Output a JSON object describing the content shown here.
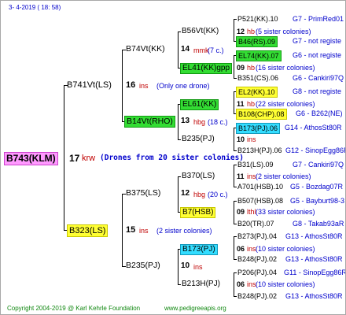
{
  "header": {
    "date_line": "3-   4-2019  ( 18:  58)"
  },
  "footer": {
    "copyright": "Copyright 2004-2019 @ Karl Kehrle Foundation",
    "website": "www.pedigreeapis.org"
  },
  "colors": {
    "pink": "#ff99ff",
    "green": "#33dd33",
    "yellow": "#ffff33",
    "cyan": "#33ddff",
    "blue_text": "#0000cc",
    "red_text": "#c00000"
  },
  "root": {
    "name": "B743(KLM)",
    "score": "17",
    "marker": "krw",
    "colony_note": "(Drones from 20 sister colonies)"
  },
  "gen1": {
    "upper": {
      "name": "B741Vt(LS)",
      "score": "16",
      "marker": "ins",
      "note": "(Only one drone)"
    },
    "lower": {
      "name": "B323(LS)",
      "score": "15",
      "marker": "ins",
      "note": "(2 sister colonies)"
    }
  },
  "gen2": {
    "b74vt": {
      "name": "B74Vt(KK)",
      "score": "14",
      "marker": "mmk",
      "note": "(7 c.)"
    },
    "b14vt": {
      "name": "B14Vt(RHO)",
      "score": "13",
      "marker": "hbg",
      "note": "(18 c.)"
    },
    "b375": {
      "name": "B375(LS)",
      "score": "12",
      "marker": "hbg",
      "note": "(20 c.)"
    },
    "b235": {
      "name": "B235(PJ)",
      "score": "10",
      "marker": "ins",
      "note": ""
    }
  },
  "gen3": [
    {
      "name": "B56Vt(KK)",
      "score": "12",
      "marker": "hb",
      "note": "(5 sister colonies)"
    },
    {
      "name": "EL41(KK)gpp",
      "score": "09",
      "marker": "hb",
      "note": "(16 sister colonies)"
    },
    {
      "name": "EL61(KK)",
      "score": "11",
      "marker": "hb",
      "note": "(22 sister colonies)"
    },
    {
      "name": "B235(PJ)",
      "score": "10",
      "marker": "ins",
      "note": ""
    },
    {
      "name": "B370(LS)",
      "score": "11",
      "marker": "ins",
      "note": "(2 sister colonies)"
    },
    {
      "name": "B7(HSB)",
      "score": "09",
      "marker": "lthl",
      "note": "(33 sister colonies)"
    },
    {
      "name": "B173(PJ)",
      "score": "06",
      "marker": "ins",
      "note": "(10 sister colonies)"
    },
    {
      "name": "B213H(PJ)",
      "score": "06",
      "marker": "ins",
      "note": "(10 sister colonies)"
    }
  ],
  "gen4": [
    {
      "name": "P521(KK).10",
      "info": "G7 - PrimRed01"
    },
    {
      "name": "B46(RS).09",
      "info": "G7 - not registe"
    },
    {
      "name": "EL74(KK).07",
      "info": "G6 - not registe"
    },
    {
      "name": "B351(CS).06",
      "info": "G6 - Cankiri97Q"
    },
    {
      "name": "EL2(KK).10",
      "info": "G8 - not registe"
    },
    {
      "name": "B108(CHP).08",
      "info": "G6 - B262(NE)"
    },
    {
      "name": "B173(PJ).06",
      "info": "G14 - AthosSt80R"
    },
    {
      "name": "B213H(PJ).06",
      "info": "G12 - SinopEgg86R"
    },
    {
      "name": "B31(LS).09",
      "info": "G7 - Cankiri97Q"
    },
    {
      "name": "A701(HSB).10",
      "info": "G5 - Bozdag07R"
    },
    {
      "name": "B507(HSB).08",
      "info": "G5 - Bayburt98-3"
    },
    {
      "name": "B20(TR).07",
      "info": "G8 - Takab93aR"
    },
    {
      "name": "B273(PJ).04",
      "info": "G13 - AthosSt80R"
    },
    {
      "name": "B248(PJ).02",
      "info": "G13 - AthosSt80R"
    },
    {
      "name": "P206(PJ).04",
      "info": "G11 - SinopEgg86R"
    },
    {
      "name": "B248(PJ).02",
      "info": "G13 - AthosSt80R"
    }
  ]
}
